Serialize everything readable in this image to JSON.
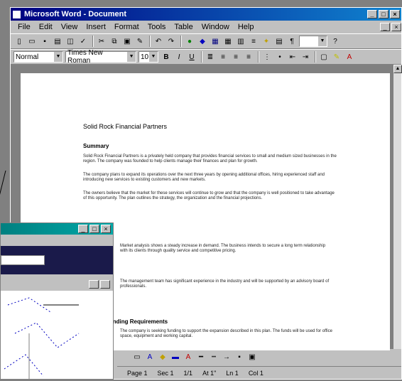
{
  "window": {
    "title": "Microsoft Word - Document"
  },
  "menubar": {
    "items": [
      "File",
      "Edit",
      "View",
      "Insert",
      "Format",
      "Tools",
      "Table",
      "Window",
      "Help"
    ]
  },
  "formatting": {
    "style": "Normal",
    "font": "Times New Roman",
    "size": "10"
  },
  "document": {
    "title": "Solid Rock Financial Partners",
    "heading1": "Summary",
    "heading2": "Funding Requirements",
    "paragraphs": [
      "Solid Rock Financial Partners is a privately held company that provides financial services to small and medium sized businesses in the region. The company was founded to help clients manage their finances and plan for growth.",
      "The company plans to expand its operations over the next three years by opening additional offices, hiring experienced staff and introducing new services to existing customers and new markets.",
      "The owners believe that the market for these services will continue to grow and that the company is well positioned to take advantage of this opportunity. The plan outlines the strategy, the organization and the financial projections.",
      "Market analysis shows a steady increase in demand. The business intends to secure a long term relationship with its clients through quality service and competitive pricing.",
      "The management team has significant experience in the industry and will be supported by an advisory board of professionals.",
      "The company is seeking funding to support the expansion described in this plan. The funds will be used for office space, equipment and working capital."
    ]
  },
  "statusbar": {
    "page": "Page 1",
    "section": "Sec 1",
    "pages": "1/1",
    "position": "At 1\"",
    "line": "Ln 1",
    "col": "Col 1"
  }
}
